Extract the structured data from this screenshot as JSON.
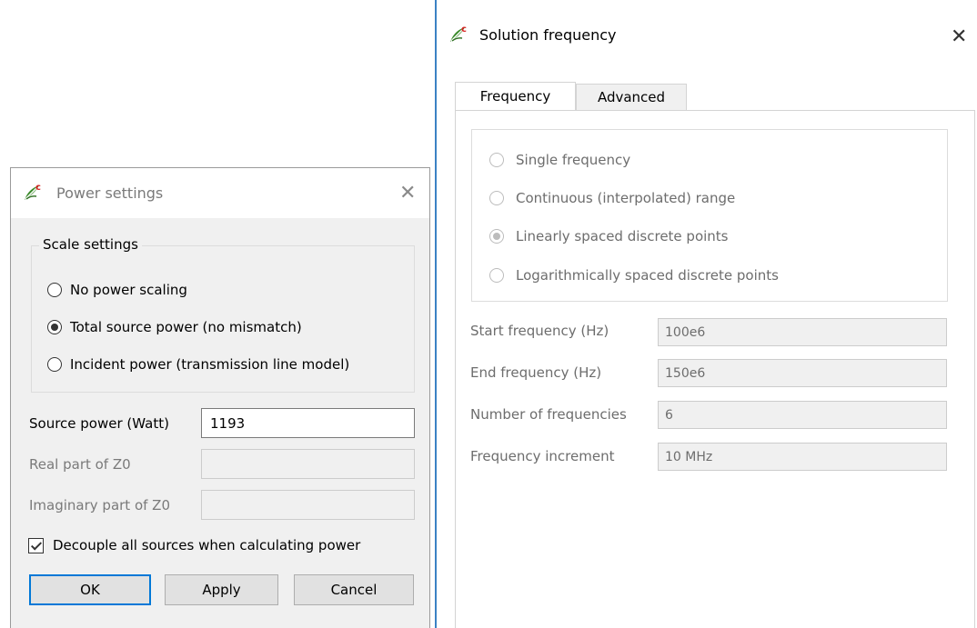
{
  "solution_window": {
    "title": "Solution frequency",
    "close_glyph": "✕",
    "tabs": [
      {
        "label": "Frequency",
        "active": true
      },
      {
        "label": "Advanced",
        "active": false
      }
    ],
    "frequency_options": [
      {
        "label": "Single frequency",
        "checked": false,
        "enabled": false
      },
      {
        "label": "Continuous (interpolated) range",
        "checked": false,
        "enabled": false
      },
      {
        "label": "Linearly spaced discrete points",
        "checked": true,
        "enabled": false
      },
      {
        "label": "Logarithmically spaced discrete points",
        "checked": false,
        "enabled": false
      }
    ],
    "fields": [
      {
        "label": "Start frequency (Hz)",
        "value": "100e6"
      },
      {
        "label": "End frequency (Hz)",
        "value": "150e6"
      },
      {
        "label": "Number of frequencies",
        "value": "6"
      },
      {
        "label": "Frequency increment",
        "value": "10 MHz"
      }
    ]
  },
  "power_window": {
    "title": "Power settings",
    "close_glyph": "✕",
    "scale_group_label": "Scale settings",
    "scale_options": [
      {
        "label": "No power scaling",
        "checked": false
      },
      {
        "label": "Total source power (no mismatch)",
        "checked": true
      },
      {
        "label": "Incident power (transmission line model)",
        "checked": false
      }
    ],
    "source_power": {
      "label": "Source power (Watt)",
      "value": "1193"
    },
    "real_z0": {
      "label": "Real part of Z0",
      "value": ""
    },
    "imag_z0": {
      "label": "Imaginary part of Z0",
      "value": ""
    },
    "decouple": {
      "label": "Decouple all sources when calculating power",
      "checked": true
    },
    "buttons": {
      "ok": "OK",
      "apply": "Apply",
      "cancel": "Cancel"
    }
  },
  "icons": {
    "app_icon": "app-leaf-icon",
    "colors": {
      "leaf_green": "#3a8a2a",
      "leaf_red": "#d62020",
      "accent_blue": "#0078d7",
      "window_border_blue": "#3b82c4"
    }
  }
}
